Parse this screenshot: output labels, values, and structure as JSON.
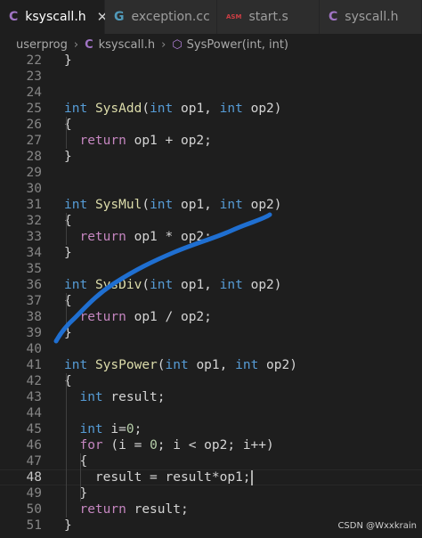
{
  "tabs": [
    {
      "icon": "C",
      "label": "ksyscall.h",
      "active": true,
      "close": "✕"
    },
    {
      "icon": "G",
      "label": "exception.cc",
      "active": false
    },
    {
      "icon": "ASM",
      "label": "start.s",
      "active": false
    },
    {
      "icon": "C",
      "label": "syscall.h",
      "active": false
    }
  ],
  "breadcrumb": {
    "folder": "userprog",
    "file_icon": "C",
    "file": "ksyscall.h",
    "symbol": "SysPower(int, int)"
  },
  "editor": {
    "current_line": "48",
    "lines": [
      {
        "n": "22",
        "t": [
          "}"
        ]
      },
      {
        "n": "23",
        "t": []
      },
      {
        "n": "24",
        "t": []
      },
      {
        "n": "25",
        "t": [
          "int",
          " ",
          "SysAdd",
          "(",
          "int",
          " op1, ",
          "int",
          " op2)"
        ]
      },
      {
        "n": "26",
        "t": [
          "{"
        ]
      },
      {
        "n": "27",
        "t": [
          "  ",
          "return",
          " op1 + op2;"
        ]
      },
      {
        "n": "28",
        "t": [
          "}"
        ]
      },
      {
        "n": "29",
        "t": []
      },
      {
        "n": "30",
        "t": []
      },
      {
        "n": "31",
        "t": [
          "int",
          " ",
          "SysMul",
          "(",
          "int",
          " op1, ",
          "int",
          " op2)"
        ]
      },
      {
        "n": "32",
        "t": [
          "{"
        ]
      },
      {
        "n": "33",
        "t": [
          "  ",
          "return",
          " op1 * op2;"
        ]
      },
      {
        "n": "34",
        "t": [
          "}"
        ]
      },
      {
        "n": "35",
        "t": []
      },
      {
        "n": "36",
        "t": [
          "int",
          " ",
          "SysDiv",
          "(",
          "int",
          " op1, ",
          "int",
          " op2)"
        ]
      },
      {
        "n": "37",
        "t": [
          "{"
        ]
      },
      {
        "n": "38",
        "t": [
          "  ",
          "return",
          " op1 / op2;"
        ]
      },
      {
        "n": "39",
        "t": [
          "}"
        ]
      },
      {
        "n": "40",
        "t": []
      },
      {
        "n": "41",
        "t": [
          "int",
          " ",
          "SysPower",
          "(",
          "int",
          " op1, ",
          "int",
          " op2)"
        ]
      },
      {
        "n": "42",
        "t": [
          "{"
        ]
      },
      {
        "n": "43",
        "t": [
          "  ",
          "int",
          " result;"
        ]
      },
      {
        "n": "44",
        "t": []
      },
      {
        "n": "45",
        "t": [
          "  ",
          "int",
          " i=",
          "0",
          ";"
        ]
      },
      {
        "n": "46",
        "t": [
          "  ",
          "for",
          " (i = ",
          "0",
          "; i < op2; i++)"
        ]
      },
      {
        "n": "47",
        "t": [
          "  {"
        ]
      },
      {
        "n": "48",
        "t": [
          "    result = result*op1;"
        ]
      },
      {
        "n": "49",
        "t": [
          "  }"
        ]
      },
      {
        "n": "50",
        "t": [
          "  ",
          "return",
          " result;"
        ]
      },
      {
        "n": "51",
        "t": [
          "}"
        ]
      }
    ]
  },
  "colors": {
    "background": "#1e1e1e",
    "keyword": "#569cd6",
    "control": "#c586c0",
    "function": "#dcdcaa",
    "number": "#b5cea8",
    "annotation_ink": "#1f6fd1"
  },
  "watermark": "CSDN @Wxxkrain"
}
